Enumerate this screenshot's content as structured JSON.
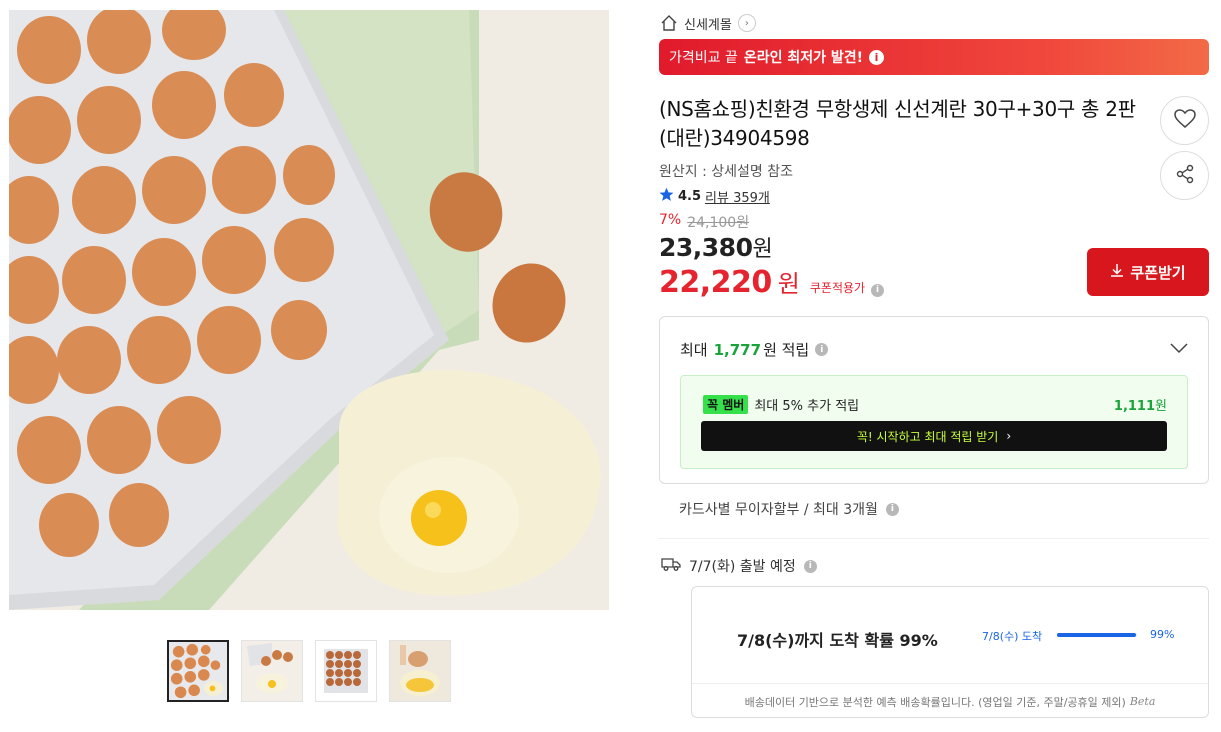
{
  "store": {
    "name": "신세계몰"
  },
  "banner": {
    "prefix": "가격비교 끝",
    "highlight": "온라인 최저가 발견!",
    "info_glyph": "i"
  },
  "product": {
    "title": "(NS홈쇼핑)친환경 무항생제 신선계란 30구+30구 총 2판 (대란)34904598",
    "origin": "원산지 : 상세설명 참조",
    "rating": "4.5",
    "review_label": "리뷰 359개"
  },
  "price": {
    "discount_pct": "7%",
    "original": "24,100원",
    "sale_amount": "23,380",
    "sale_unit": "원",
    "coupon_amount": "22,220",
    "coupon_unit": "원",
    "coupon_tag": "쿠폰적용가",
    "coupon_button": "쿠폰받기"
  },
  "points": {
    "prefix": "최대",
    "amount": "1,777",
    "suffix": "원 적립",
    "member_badge": "꼭",
    "member_label": "멤버",
    "member_text": "최대 5% 추가 적립",
    "member_amount": "1,111",
    "member_unit": "원",
    "start_button": "꼭! 시작하고 최대 적립 받기",
    "start_arrow": "›"
  },
  "card": {
    "text": "카드사별 무이자할부 / 최대 3개월"
  },
  "shipping": {
    "text": "7/7(화) 출발 예정",
    "arrival_main": "7/8(수)까지 도착 확률 99%",
    "bar_label": "7/8(수) 도착",
    "bar_percent": "99%",
    "bar_fraction": 0.99,
    "footnote": "배송데이터 기반으로 분석한 예측 배송확률입니다. (영업일 기준, 주말/공휴일 제외)",
    "beta": "Beta"
  },
  "colors": {
    "accent_red": "#d7161d",
    "price_red": "#e5242f",
    "points_green": "#1aa33a",
    "member_green": "#36e04a",
    "delivery_blue": "#1a64e6"
  },
  "icons": [
    "home-icon",
    "chevron-right-icon",
    "info-icon",
    "heart-icon",
    "share-icon",
    "star-icon",
    "download-icon",
    "chevron-down-icon",
    "truck-icon"
  ]
}
